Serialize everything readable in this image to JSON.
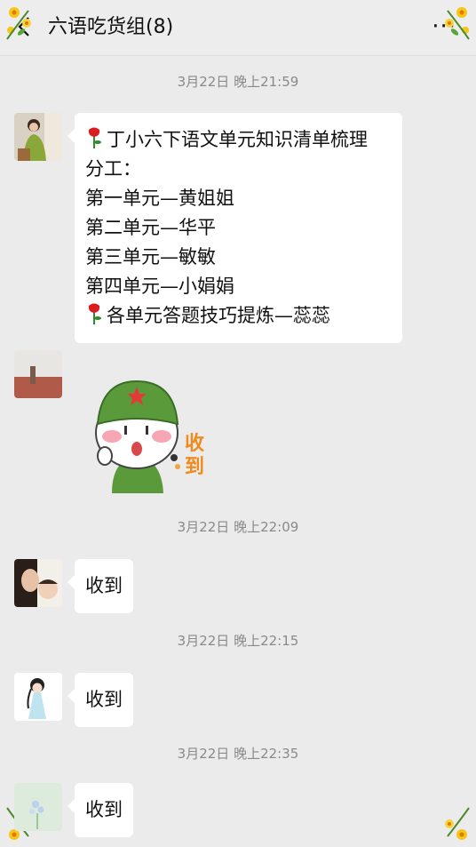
{
  "header": {
    "title": "六语吃货组(8)",
    "more_label": "···",
    "back_icon": "chevron-left-icon"
  },
  "messages": [
    {
      "time": "3月22日 晚上21:59",
      "lines": [
        "丁小六下语文单元知识清单梳理",
        "分工：",
        "第一单元—黄姐姐",
        "第二单元—华平",
        "第三单元—敏敏",
        "第四单元—小娟娟",
        "各单元答题技巧提炼—蕊蕊"
      ]
    },
    {
      "sticker_text": "收到"
    },
    {
      "time": "3月22日 晚上22:09",
      "text": "收到"
    },
    {
      "time": "3月22日 晚上22:15",
      "text": "收到"
    },
    {
      "time": "3月22日 晚上22:35",
      "text": "收到"
    }
  ],
  "colors": {
    "background": "#ebebeb",
    "bubble": "#ffffff",
    "timestamp": "#8a8a8a",
    "sticker_green": "#5a9a3a"
  }
}
